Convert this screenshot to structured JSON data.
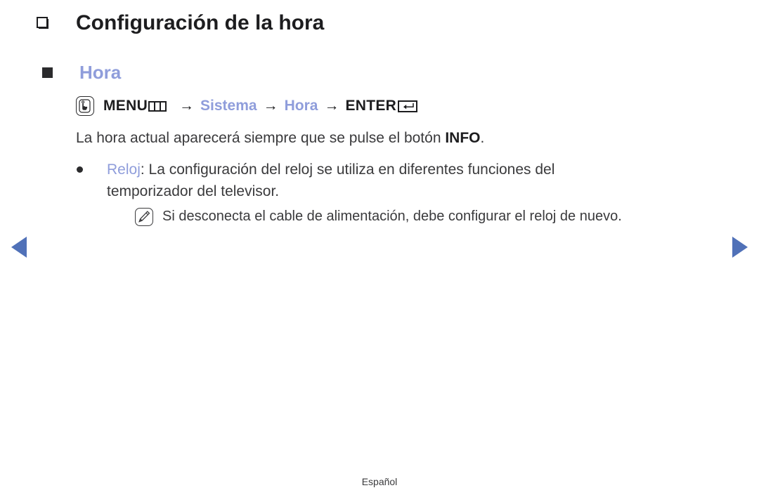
{
  "page": {
    "title": "Configuración de la hora",
    "title_bullet_icon": "hollow-square-bullet-icon",
    "background_color": "#ffffff",
    "accent_blue": "#8f9ddb",
    "nav_arrow_color": "#5071b8",
    "text_color": "#3a3a3c"
  },
  "section": {
    "bullet_icon": "filled-square-bullet-icon",
    "heading": "Hora"
  },
  "menu_path": {
    "remote_icon": "remote-button-press-icon",
    "menu_label": "MENU",
    "menu_grid_icon": "menu-grid-icon",
    "arrow": "→",
    "step_system": "Sistema",
    "step_time": "Hora",
    "enter_label": "ENTER",
    "enter_icon": "enter-return-key-icon"
  },
  "paragraphs": {
    "info_line_before": "La hora actual aparecerá siempre que se pulse el botón ",
    "info_button": "INFO",
    "info_line_after": "."
  },
  "bullet_item": {
    "bullet_icon": "round-bullet-icon",
    "term": "Reloj",
    "line1_after_term": ": La configuración del reloj se utiliza en diferentes funciones del",
    "line2": "temporizador del televisor."
  },
  "note": {
    "icon": "note-pencil-icon",
    "text": "Si desconecta el cable de alimentación, debe configurar el reloj de nuevo."
  },
  "navigation": {
    "prev_icon": "previous-page-arrow-icon",
    "next_icon": "next-page-arrow-icon"
  },
  "footer": {
    "language": "Español"
  }
}
